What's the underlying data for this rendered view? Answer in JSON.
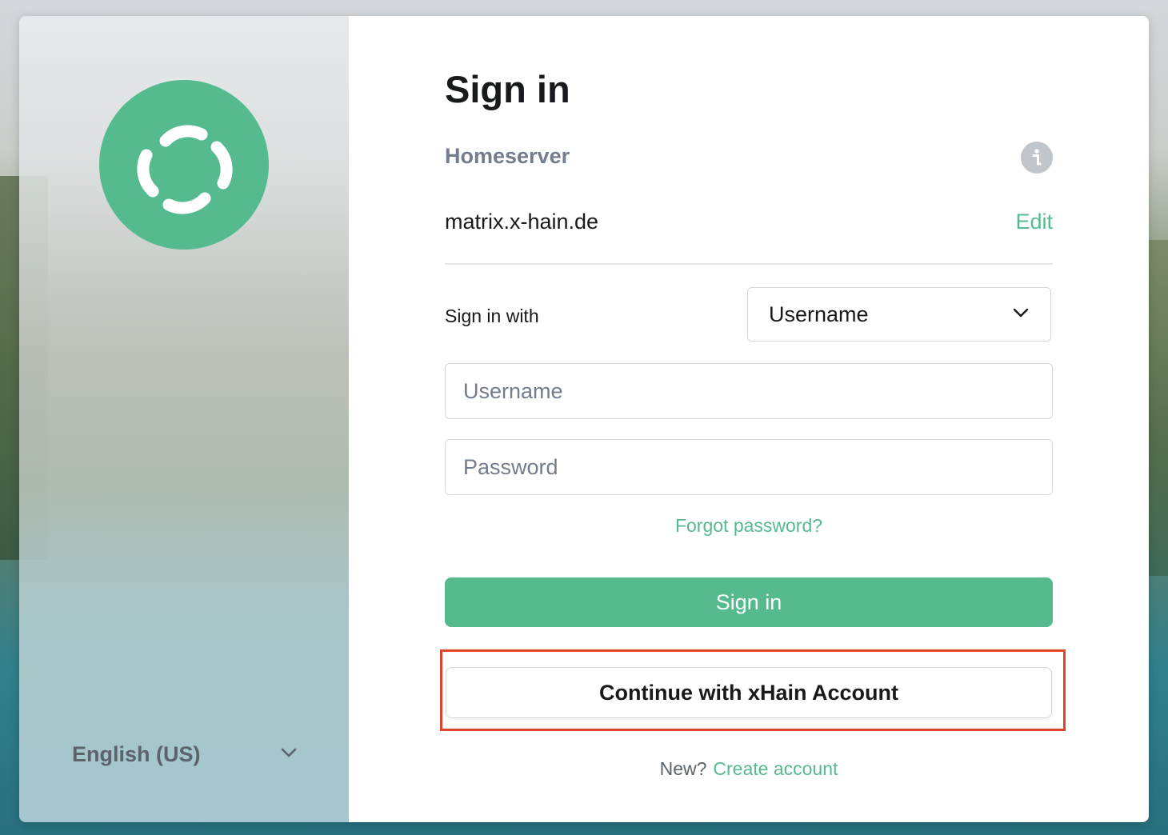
{
  "icons": {
    "logo": "element-logo-icon",
    "info": "info-icon",
    "chevron": "chevron-down-icon"
  },
  "colors": {
    "accent": "#55bb8e",
    "highlight": "#e0452e",
    "text": "#17191c",
    "muted": "#737d8c"
  },
  "sidebar": {
    "language": "English (US)"
  },
  "login": {
    "title": "Sign in",
    "homeserver_label": "Homeserver",
    "homeserver_name": "matrix.x-hain.de",
    "edit_label": "Edit",
    "sign_in_with_label": "Sign in with",
    "sign_in_with_value": "Username",
    "username_placeholder": "Username",
    "password_placeholder": "Password",
    "forgot_label": "Forgot password?",
    "sign_in_button": "Sign in",
    "sso_button": "Continue with xHain Account",
    "new_label": "New?",
    "create_account_label": "Create account"
  }
}
